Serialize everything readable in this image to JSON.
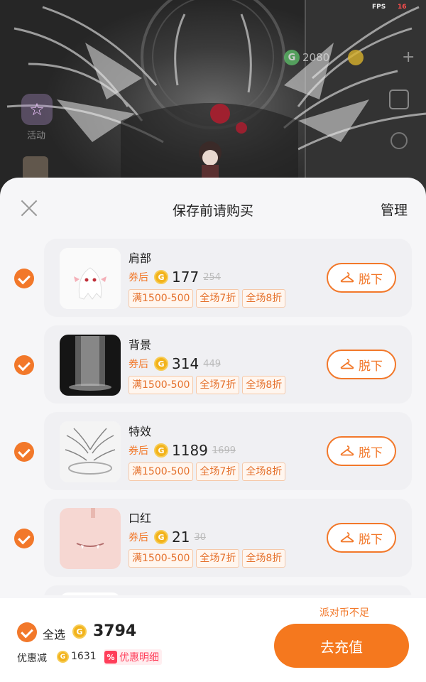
{
  "hud": {
    "fps_label": "FPS",
    "fps_value": "16",
    "coin_letter": "G",
    "coin_value": "2080",
    "left_label": "活动"
  },
  "sheet": {
    "title": "保存前请购买",
    "manage_label": "管理"
  },
  "items": [
    {
      "name": "肩部",
      "coupon_label": "券后",
      "price": "177",
      "original_price": "254",
      "tags": [
        "满1500-500",
        "全场7折",
        "全场8折"
      ],
      "action_label": "脱下",
      "checked": true
    },
    {
      "name": "背景",
      "coupon_label": "券后",
      "price": "314",
      "original_price": "449",
      "tags": [
        "满1500-500",
        "全场7折",
        "全场8折"
      ],
      "action_label": "脱下",
      "checked": true
    },
    {
      "name": "特效",
      "coupon_label": "券后",
      "price": "1189",
      "original_price": "1699",
      "tags": [
        "满1500-500",
        "全场7折",
        "全场8折"
      ],
      "action_label": "脱下",
      "checked": true
    },
    {
      "name": "口红",
      "coupon_label": "券后",
      "price": "21",
      "original_price": "30",
      "tags": [
        "满1500-500",
        "全场7折",
        "全场8折"
      ],
      "action_label": "脱下",
      "checked": true
    }
  ],
  "footer": {
    "insufficient_text": "派对币不足",
    "select_all_label": "全选",
    "total": "3794",
    "discount_label": "优惠减",
    "discount_value": "1631",
    "discount_badge": "%",
    "detail_label": "优惠明细",
    "recharge_label": "去充值"
  },
  "colors": {
    "accent": "#f2782a",
    "coin": "#f2b31c",
    "discount_red": "#ff3e5a"
  }
}
